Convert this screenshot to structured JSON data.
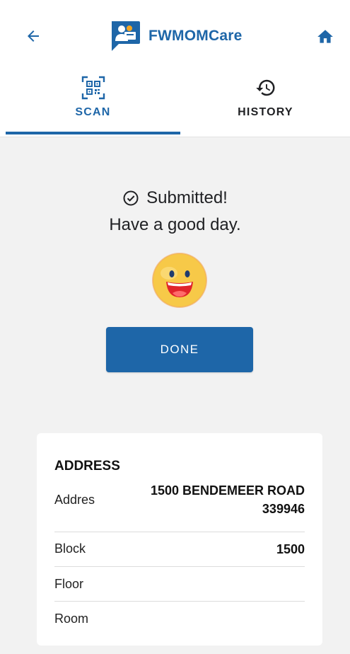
{
  "app": {
    "name": "FWMOMCare"
  },
  "colors": {
    "primary": "#1e66a8",
    "background": "#f2f2f2",
    "card": "#ffffff"
  },
  "header": {
    "back_icon": "arrow-left-icon",
    "logo_icon": "fwmomcare-logo-icon",
    "home_icon": "home-icon"
  },
  "tabs": [
    {
      "label": "SCAN",
      "icon": "qr-code-icon",
      "active": true
    },
    {
      "label": "HISTORY",
      "icon": "history-icon",
      "active": false
    }
  ],
  "status": {
    "icon": "check-circle-icon",
    "line1": "Submitted!",
    "line2": "Have a good day."
  },
  "smiley_icon": "smiley-face-icon",
  "done_button": {
    "label": "DONE"
  },
  "address_card": {
    "title": "ADDRESS",
    "address_label": "Addres",
    "address_line1": "1500 BENDEMEER ROAD",
    "address_line2": "339946",
    "block_label": "Block",
    "block_value": "1500",
    "floor_label": "Floor",
    "floor_value": "",
    "room_label": "Room",
    "room_value": ""
  }
}
